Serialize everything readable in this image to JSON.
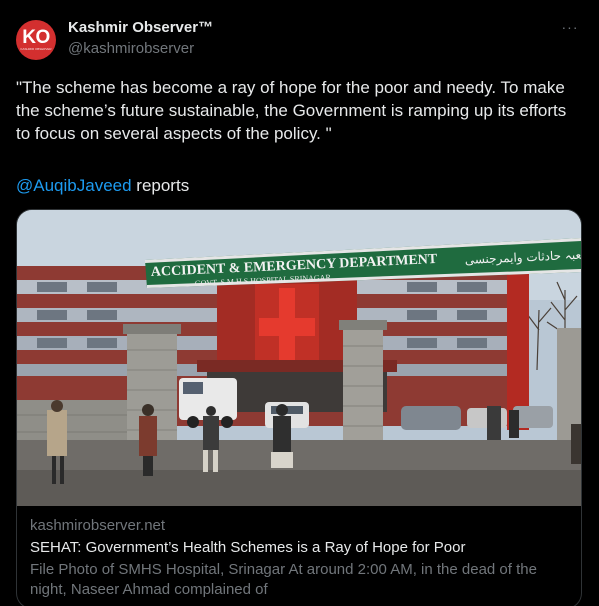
{
  "account": {
    "display_name": "Kashmir Observer™",
    "handle": "@kashmirobserver",
    "avatar_mark": "KO",
    "avatar_sub": "KASHMIR OBSERVER"
  },
  "menu": {
    "more_label": "···"
  },
  "tweet": {
    "text": "\"The scheme has become a ray of hope for the poor and needy. To make the scheme’s future sustainable, the Government is ramping up its efforts to focus on several aspects of the policy. \"",
    "mention": "@AuqibJaveed",
    "after_mention": " reports"
  },
  "card": {
    "domain": "kashmirobserver.net",
    "title": "SEHAT: Government’s Health Schemes is a Ray of Hope for Poor",
    "description": "File Photo of SMHS Hospital, Srinagar At around 2:00 AM,  in the dead of the night, Naseer Ahmad complained of",
    "sign_main": "ACCIDENT & EMERGENCY DEPARTMENT",
    "sign_sub": "GOVT. S.M.H.S HOSPITAL SRINAGAR",
    "sign_urdu": "شعبہ حادثات وایمرجنسی"
  },
  "colors": {
    "background": "#000000",
    "text": "#e7e9ea",
    "muted": "#71767b",
    "link": "#1d9bf0",
    "avatar": "#d32f2f",
    "border": "#2f3336"
  }
}
